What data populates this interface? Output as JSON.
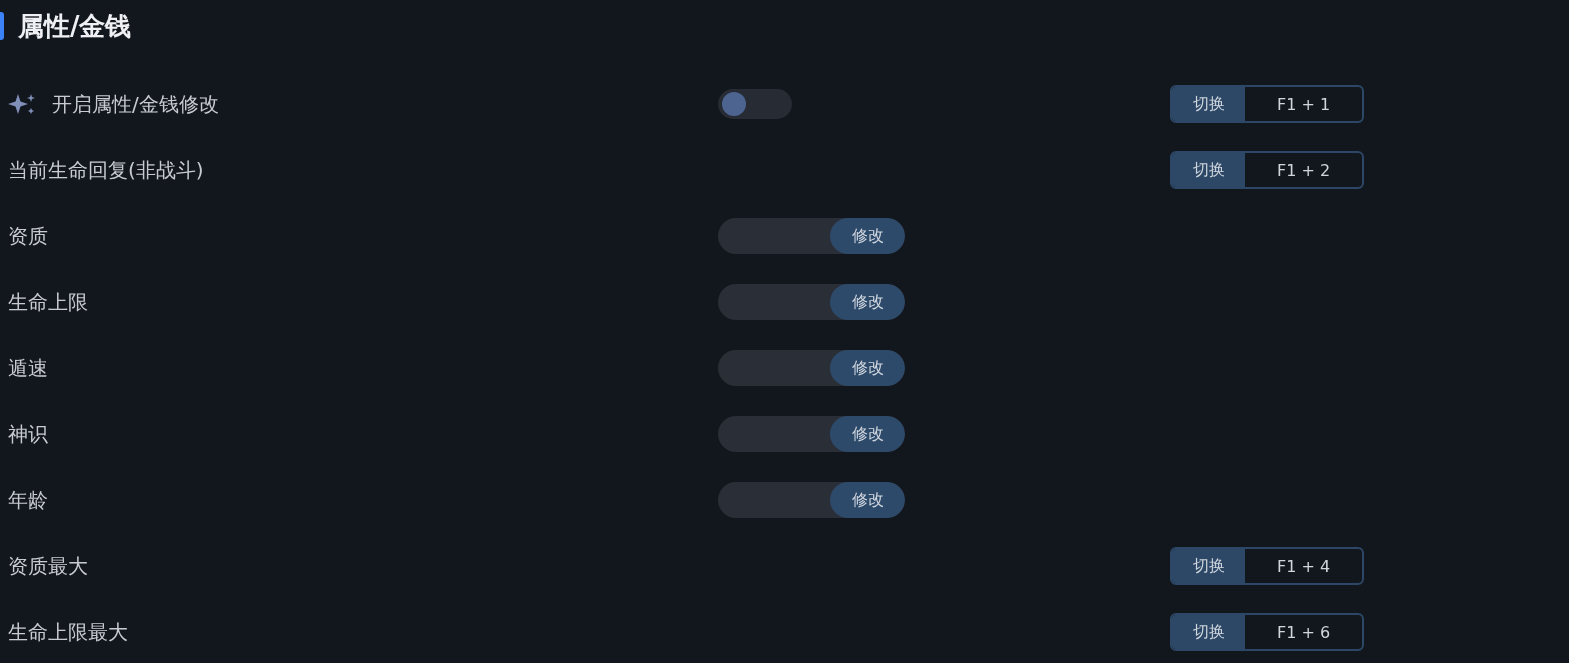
{
  "section": {
    "title": "属性/金钱"
  },
  "rows": [
    {
      "kind": "toggle",
      "label": "开启属性/金钱修改",
      "on": false,
      "hotkey": {
        "action": "切换",
        "keys": "F1 + 1"
      }
    },
    {
      "kind": "plain",
      "label": "当前生命回复(非战斗)",
      "hotkey": {
        "action": "切换",
        "keys": "F1 + 2"
      }
    },
    {
      "kind": "edit",
      "label": "资质",
      "button": "修改"
    },
    {
      "kind": "edit",
      "label": "生命上限",
      "button": "修改"
    },
    {
      "kind": "edit",
      "label": "遁速",
      "button": "修改"
    },
    {
      "kind": "edit",
      "label": "神识",
      "button": "修改"
    },
    {
      "kind": "edit",
      "label": "年龄",
      "button": "修改"
    },
    {
      "kind": "plain",
      "label": "资质最大",
      "hotkey": {
        "action": "切换",
        "keys": "F1 + 4"
      }
    },
    {
      "kind": "plain",
      "label": "生命上限最大",
      "hotkey": {
        "action": "切换",
        "keys": "F1 + 6"
      }
    }
  ]
}
